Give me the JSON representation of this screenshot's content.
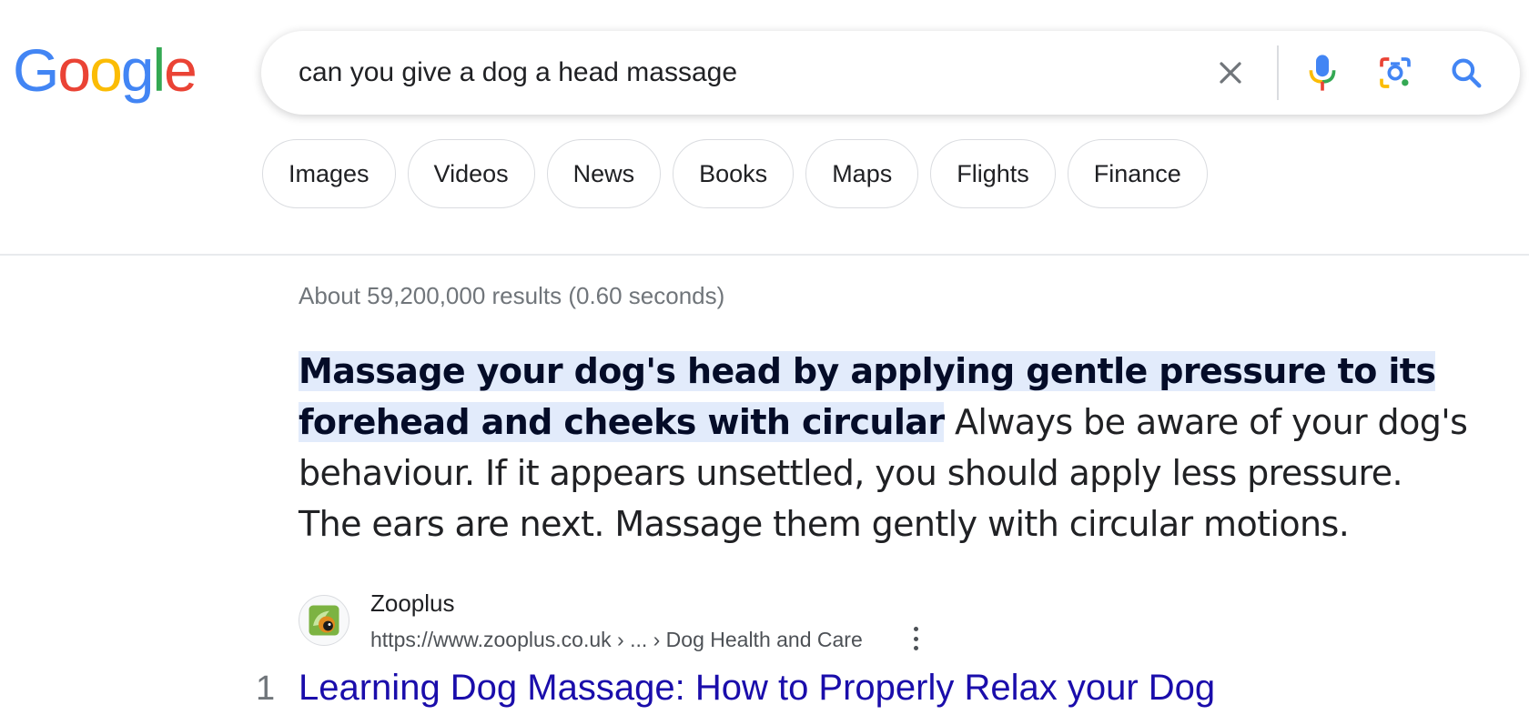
{
  "logo": {
    "letters": [
      "G",
      "o",
      "o",
      "g",
      "l",
      "e"
    ]
  },
  "search": {
    "query": "can you give a dog a head massage"
  },
  "icons": {
    "clear": "close-icon",
    "voice": "microphone-icon",
    "lens": "camera-lens-icon",
    "search": "search-icon"
  },
  "chips": [
    "Images",
    "Videos",
    "News",
    "Books",
    "Maps",
    "Flights",
    "Finance"
  ],
  "result_stats": "About 59,200,000 results (0.60 seconds)",
  "snippet": {
    "highlight": "Massage your dog's head by applying gentle pressure to its forehead and cheeks with circular",
    "rest": " Always be aware of your dog's behaviour. If it appears unsettled, you should apply less pressure. The ears are next. Massage them gently with circular motions."
  },
  "source": {
    "name": "Zooplus",
    "url": "https://www.zooplus.co.uk › ... › Dog Health and Care",
    "rank": "1",
    "title": "Learning Dog Massage: How to Properly Relax your Dog"
  },
  "colors": {
    "blue": "#4285F4",
    "red": "#EA4335",
    "yellow": "#FBBC05",
    "green": "#34A853",
    "link": "#1a0dab"
  }
}
